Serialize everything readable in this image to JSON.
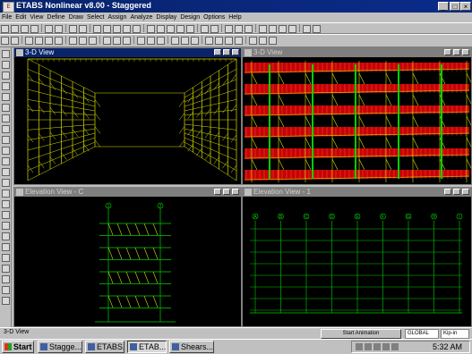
{
  "app": {
    "title": "ETABS Nonlinear v8.00 - Staggered"
  },
  "menu": [
    "File",
    "Edit",
    "View",
    "Define",
    "Draw",
    "Select",
    "Assign",
    "Analyze",
    "Display",
    "Design",
    "Options",
    "Help"
  ],
  "panes": {
    "tl": {
      "title": "3-D View"
    },
    "tr": {
      "title": "3-D View"
    },
    "bl": {
      "title": "Elevation View - C",
      "grid_bubbles": [
        "1",
        "2"
      ]
    },
    "br": {
      "title": "Elevation View - 1",
      "grid_bubbles": [
        "A",
        "B",
        "C",
        "D",
        "E",
        "F",
        "G",
        "H",
        "I"
      ]
    }
  },
  "status": {
    "left": "3-D View",
    "animation_button": "Start Animation",
    "coord_system": "GLOBAL",
    "units": "Kip-in"
  },
  "taskbar": {
    "start": "Start",
    "tasks": [
      "Stagge...",
      "ETABS...",
      "ETAB...",
      "Shears..."
    ],
    "clock": "5:32 AM"
  },
  "colors": {
    "structure": "#d8e000",
    "beam": "#00d000",
    "slab": "#c80000",
    "active_caption": "#0a246a"
  }
}
